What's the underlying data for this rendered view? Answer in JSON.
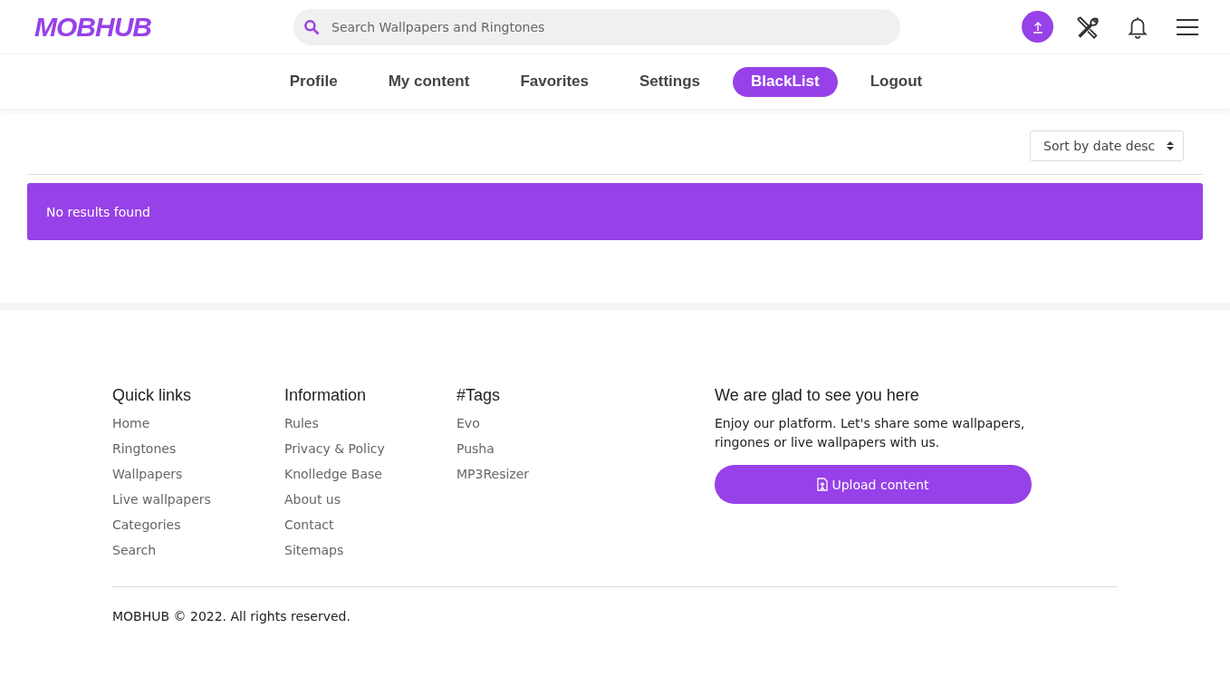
{
  "header": {
    "logo": "MOBHUB",
    "search": {
      "placeholder": "Search Wallpapers and Ringtones"
    }
  },
  "tabs": [
    {
      "label": "Profile",
      "selected": false
    },
    {
      "label": "My content",
      "selected": false
    },
    {
      "label": "Favorites",
      "selected": false
    },
    {
      "label": "Settings",
      "selected": false
    },
    {
      "label": "BlackList",
      "selected": true
    },
    {
      "label": "Logout",
      "selected": false
    }
  ],
  "sort": {
    "value": "Sort by date desc"
  },
  "alert": "No results found",
  "footer": {
    "columns": [
      {
        "title": "Quick links",
        "links": [
          "Home",
          "Ringtones",
          "Wallpapers",
          "Live wallpapers",
          "Categories",
          "Search"
        ]
      },
      {
        "title": "Information",
        "links": [
          "Rules",
          "Privacy & Policy",
          "Knolledge Base",
          "About us",
          "Contact",
          "Sitemaps"
        ]
      },
      {
        "title": "#Tags",
        "links": [
          "Evo",
          "Pusha",
          "MP3Resizer"
        ]
      }
    ],
    "promo": {
      "title": "We are glad to see you here",
      "text": "Enjoy our platform. Let's share some wallpapers, ringones or live wallpapers with us.",
      "button": "Upload content"
    },
    "copyright": "MOBHUB © 2022. All rights reserved."
  }
}
